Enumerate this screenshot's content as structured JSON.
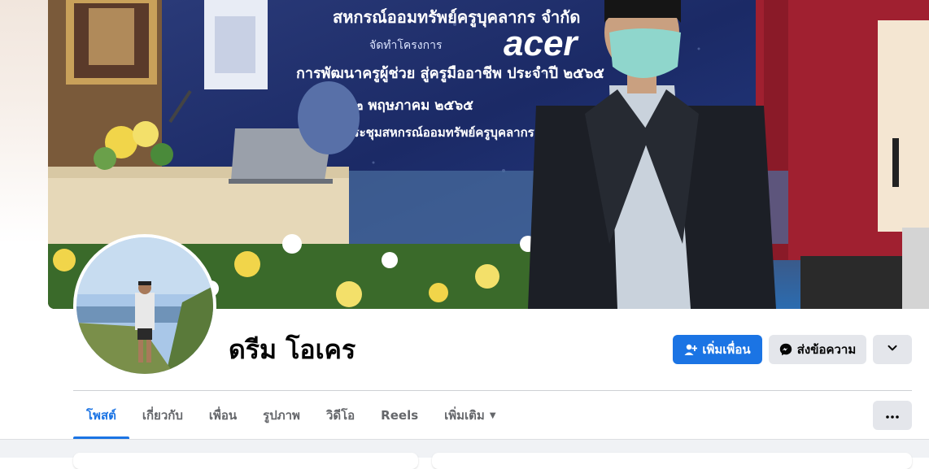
{
  "profile": {
    "name": "ดรีม โอเคร"
  },
  "cover": {
    "banner_line_1": "สหกรณ์ออมทรัพย์ครูบุคลากร จำกัด",
    "banner_line_2": "จัดทำโครงการ",
    "banner_line_3": "การพัฒนาครูผู้ช่วย สู่ครูมืออาชีพ ประจำปี ๒๕๖๕",
    "banner_line_4": "๒๒ พฤษภาคม ๒๕๖๕",
    "banner_line_5": "ประชุมสหกรณ์ออมทรัพย์ครูบุคลากร",
    "sponsor_logo": "acer"
  },
  "actions": {
    "add_friend_label": "เพิ่มเพื่อน",
    "message_label": "ส่งข้อความ"
  },
  "tabs": [
    {
      "label": "โพสต์",
      "active": true
    },
    {
      "label": "เกี่ยวกับ"
    },
    {
      "label": "เพื่อน"
    },
    {
      "label": "รูปภาพ"
    },
    {
      "label": "วิดีโอ"
    },
    {
      "label": "Reels"
    },
    {
      "label": "เพิ่มเติม"
    }
  ],
  "icons": {
    "add_friend": "person-add-icon",
    "messenger": "messenger-icon",
    "dropdown": "chevron-down-icon",
    "more": "ellipsis-icon",
    "more_caret": "caret-down-icon"
  },
  "colors": {
    "accent": "#1b74e4",
    "secondary_button": "#e4e6eb",
    "text_primary": "#050505",
    "text_secondary": "#65676b"
  }
}
